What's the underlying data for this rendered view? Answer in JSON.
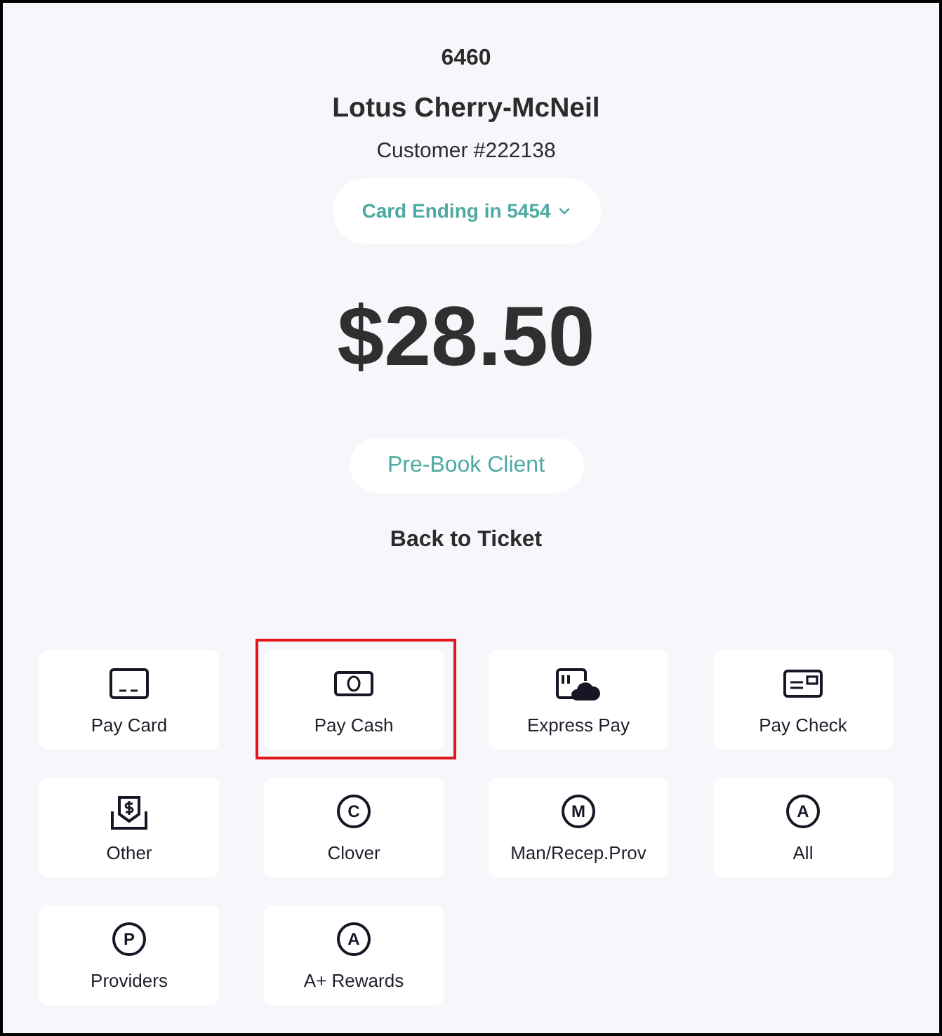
{
  "ticket_number": "6460",
  "customer_name": "Lotus Cherry-McNeil",
  "customer_id": "Customer #222138",
  "card_selector": {
    "label": "Card Ending in 5454"
  },
  "amount": "$28.50",
  "prebook_button": {
    "label": "Pre-Book Client"
  },
  "back_link": {
    "label": "Back to Ticket"
  },
  "payment_options": [
    {
      "kind": "card",
      "label": "Pay Card",
      "highlighted": false
    },
    {
      "kind": "cash",
      "label": "Pay Cash",
      "highlighted": true
    },
    {
      "kind": "express",
      "label": "Express Pay",
      "highlighted": false
    },
    {
      "kind": "check",
      "label": "Pay Check",
      "highlighted": false
    },
    {
      "kind": "other",
      "label": "Other",
      "highlighted": false
    },
    {
      "kind": "letter",
      "icon_text": "C",
      "label": "Clover",
      "highlighted": false
    },
    {
      "kind": "letter",
      "icon_text": "M",
      "label": "Man/Recep.Prov",
      "highlighted": false
    },
    {
      "kind": "letter",
      "icon_text": "A",
      "label": "All",
      "highlighted": false
    },
    {
      "kind": "letter",
      "icon_text": "P",
      "label": "Providers",
      "highlighted": false
    },
    {
      "kind": "letter",
      "icon_text": "A",
      "label": "A+ Rewards",
      "highlighted": false
    }
  ]
}
